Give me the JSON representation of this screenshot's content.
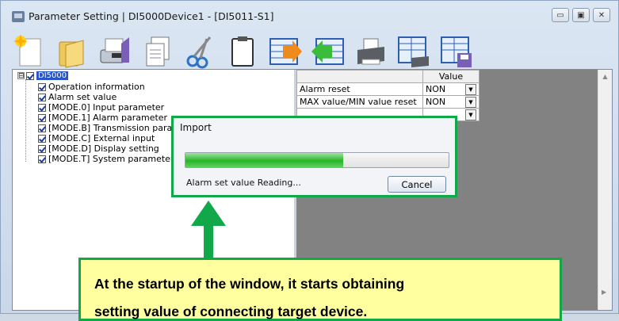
{
  "window": {
    "title": "Parameter Setting  | DI5000Device1 - [DI5011-S1]",
    "controls": {
      "minimize": "▭",
      "maximize": "▣",
      "close": "✕"
    }
  },
  "toolbar": {
    "icons": [
      "new-icon",
      "open-folder-icon",
      "save-disk-icon",
      "copy-icon",
      "cut-icon",
      "paste-icon",
      "export-icon",
      "import-icon",
      "print-icon",
      "print-preview-icon",
      "save-as-icon"
    ]
  },
  "tree": {
    "root": {
      "expander": "⊟",
      "label": "DI5000"
    },
    "items": [
      {
        "label": "Operation information"
      },
      {
        "label": "Alarm set value"
      },
      {
        "label": "[MODE.0] Input parameter"
      },
      {
        "label": "[MODE.1] Alarm parameter"
      },
      {
        "label": "[MODE.B] Transmission para"
      },
      {
        "label": "[MODE.C] External input"
      },
      {
        "label": "[MODE.D] Display setting"
      },
      {
        "label": "[MODE.T] System parameter"
      }
    ]
  },
  "grid": {
    "header": {
      "value_col": "Value"
    },
    "rows": [
      {
        "name": "Alarm reset",
        "value": "NON"
      },
      {
        "name": "MAX value/MIN value reset",
        "value": "NON"
      },
      {
        "name": "",
        "value": ""
      }
    ],
    "scroll_up": "▲",
    "scroll_right": "▶"
  },
  "dialog": {
    "title": "Import",
    "progress_fraction": 0.6,
    "status": "Alarm set value Reading...",
    "cancel_label": "Cancel"
  },
  "callout": {
    "line1": "At the startup of the window, it starts obtaining",
    "line2": "setting value of connecting target device."
  },
  "colors": {
    "accent_green": "#11a84a",
    "callout_bg": "#ffffa0",
    "selection_blue": "#2a55c8"
  }
}
